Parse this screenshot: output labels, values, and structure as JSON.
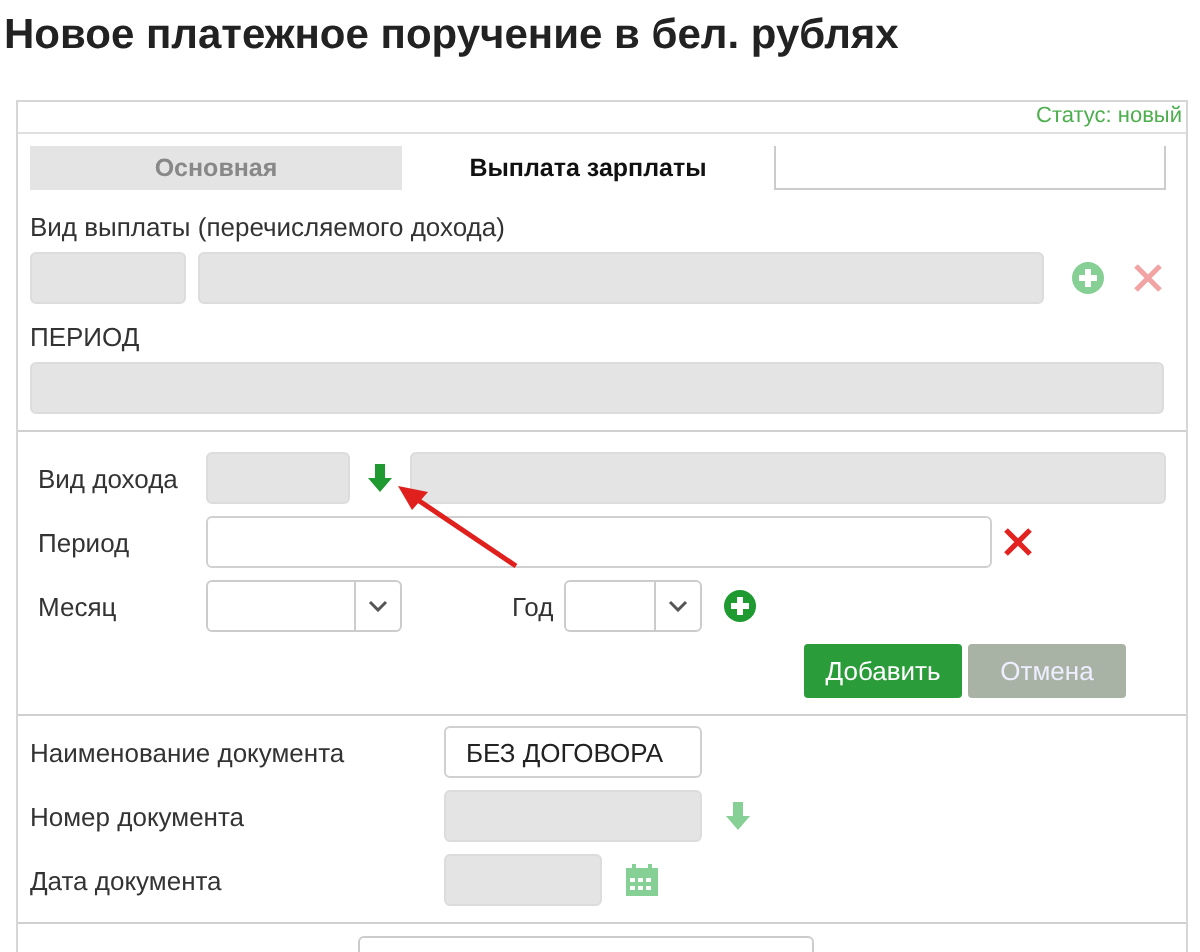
{
  "title": "Новое платежное поручение в бел. рублях",
  "status": "Статус: новый",
  "tabs": [
    {
      "label": "Основная",
      "selected": false
    },
    {
      "label": "Выплата зарплаты",
      "selected": true
    }
  ],
  "payment_kind": {
    "label": "Вид выплаты (перечисляемого дохода)",
    "code_disabled": true,
    "name_disabled": true,
    "add_disabled": true,
    "remove_disabled": true
  },
  "period_block": {
    "label": "ПЕРИОД",
    "disabled": true
  },
  "income": {
    "label": "Вид дохода",
    "code_disabled": true,
    "pick_disabled": false,
    "name_disabled": true
  },
  "period": {
    "label": "Период",
    "disabled": false,
    "remove_disabled": false
  },
  "month": {
    "label": "Месяц"
  },
  "year": {
    "label": "Год",
    "add_disabled": false
  },
  "buttons": [
    {
      "label": "Добавить",
      "kind": "primary"
    },
    {
      "label": "Отмена",
      "kind": "secondary"
    }
  ],
  "document": [
    {
      "kind": "text",
      "label": "Наименование документа",
      "value": "БЕЗ ДОГОВОРА",
      "disabled": false
    },
    {
      "kind": "pick",
      "label": "Номер документа",
      "disabled": true,
      "action_disabled": true
    },
    {
      "kind": "date",
      "label": "Дата документа",
      "disabled": true,
      "action_disabled": true
    }
  ]
}
